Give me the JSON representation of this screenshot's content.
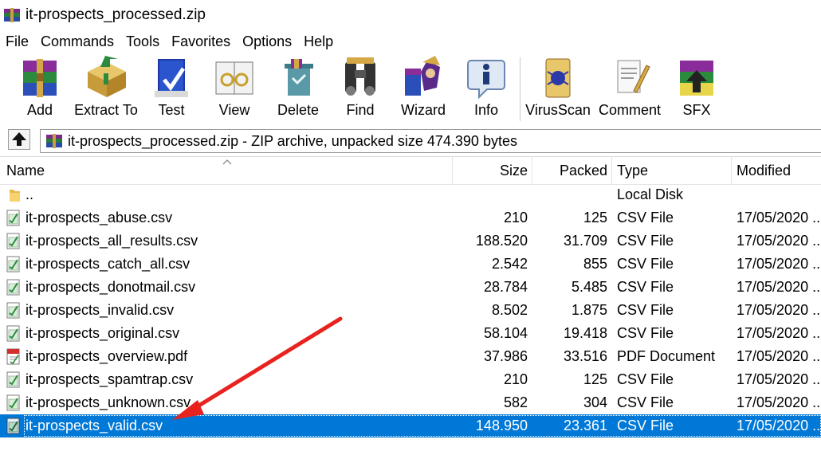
{
  "window": {
    "title": "it-prospects_processed.zip"
  },
  "menu": [
    "File",
    "Commands",
    "Tools",
    "Favorites",
    "Options",
    "Help"
  ],
  "toolbar": [
    {
      "label": "Add",
      "icon": "add-archive-icon"
    },
    {
      "label": "Extract To",
      "icon": "extract-to-icon"
    },
    {
      "label": "Test",
      "icon": "test-archive-icon"
    },
    {
      "label": "View",
      "icon": "view-icon"
    },
    {
      "label": "Delete",
      "icon": "delete-icon"
    },
    {
      "label": "Find",
      "icon": "find-binoculars-icon"
    },
    {
      "label": "Wizard",
      "icon": "wizard-icon"
    },
    {
      "label": "Info",
      "icon": "info-icon"
    },
    {
      "label": "VirusScan",
      "icon": "virus-scan-icon"
    },
    {
      "label": "Comment",
      "icon": "comment-icon"
    },
    {
      "label": "SFX",
      "icon": "sfx-icon"
    }
  ],
  "address": {
    "text": "it-prospects_processed.zip - ZIP archive, unpacked size 474.390 bytes"
  },
  "columns": {
    "name": "Name",
    "size": "Size",
    "packed": "Packed",
    "type": "Type",
    "modified": "Modified"
  },
  "files": [
    {
      "name": "..",
      "size": "",
      "packed": "",
      "type": "Local Disk",
      "modified": "",
      "icon": "folder-icon"
    },
    {
      "name": "it-prospects_abuse.csv",
      "size": "210",
      "packed": "125",
      "type": "CSV File",
      "modified": "17/05/2020 ..",
      "icon": "csv-file-icon"
    },
    {
      "name": "it-prospects_all_results.csv",
      "size": "188.520",
      "packed": "31.709",
      "type": "CSV File",
      "modified": "17/05/2020 ..",
      "icon": "csv-file-icon"
    },
    {
      "name": "it-prospects_catch_all.csv",
      "size": "2.542",
      "packed": "855",
      "type": "CSV File",
      "modified": "17/05/2020 ..",
      "icon": "csv-file-icon"
    },
    {
      "name": "it-prospects_donotmail.csv",
      "size": "28.784",
      "packed": "5.485",
      "type": "CSV File",
      "modified": "17/05/2020 ..",
      "icon": "csv-file-icon"
    },
    {
      "name": "it-prospects_invalid.csv",
      "size": "8.502",
      "packed": "1.875",
      "type": "CSV File",
      "modified": "17/05/2020 ..",
      "icon": "csv-file-icon"
    },
    {
      "name": "it-prospects_original.csv",
      "size": "58.104",
      "packed": "19.418",
      "type": "CSV File",
      "modified": "17/05/2020 ..",
      "icon": "csv-file-icon"
    },
    {
      "name": "it-prospects_overview.pdf",
      "size": "37.986",
      "packed": "33.516",
      "type": "PDF Document",
      "modified": "17/05/2020 ..",
      "icon": "pdf-file-icon"
    },
    {
      "name": "it-prospects_spamtrap.csv",
      "size": "210",
      "packed": "125",
      "type": "CSV File",
      "modified": "17/05/2020 ..",
      "icon": "csv-file-icon"
    },
    {
      "name": "it-prospects_unknown.csv",
      "size": "582",
      "packed": "304",
      "type": "CSV File",
      "modified": "17/05/2020 ..",
      "icon": "csv-file-icon"
    },
    {
      "name": "it-prospects_valid.csv",
      "size": "148.950",
      "packed": "23.361",
      "type": "CSV File",
      "modified": "17/05/2020 ..",
      "icon": "csv-file-icon",
      "selected": true
    }
  ],
  "colors": {
    "selection": "#0078d7",
    "annotation_arrow": "#e8231f"
  }
}
